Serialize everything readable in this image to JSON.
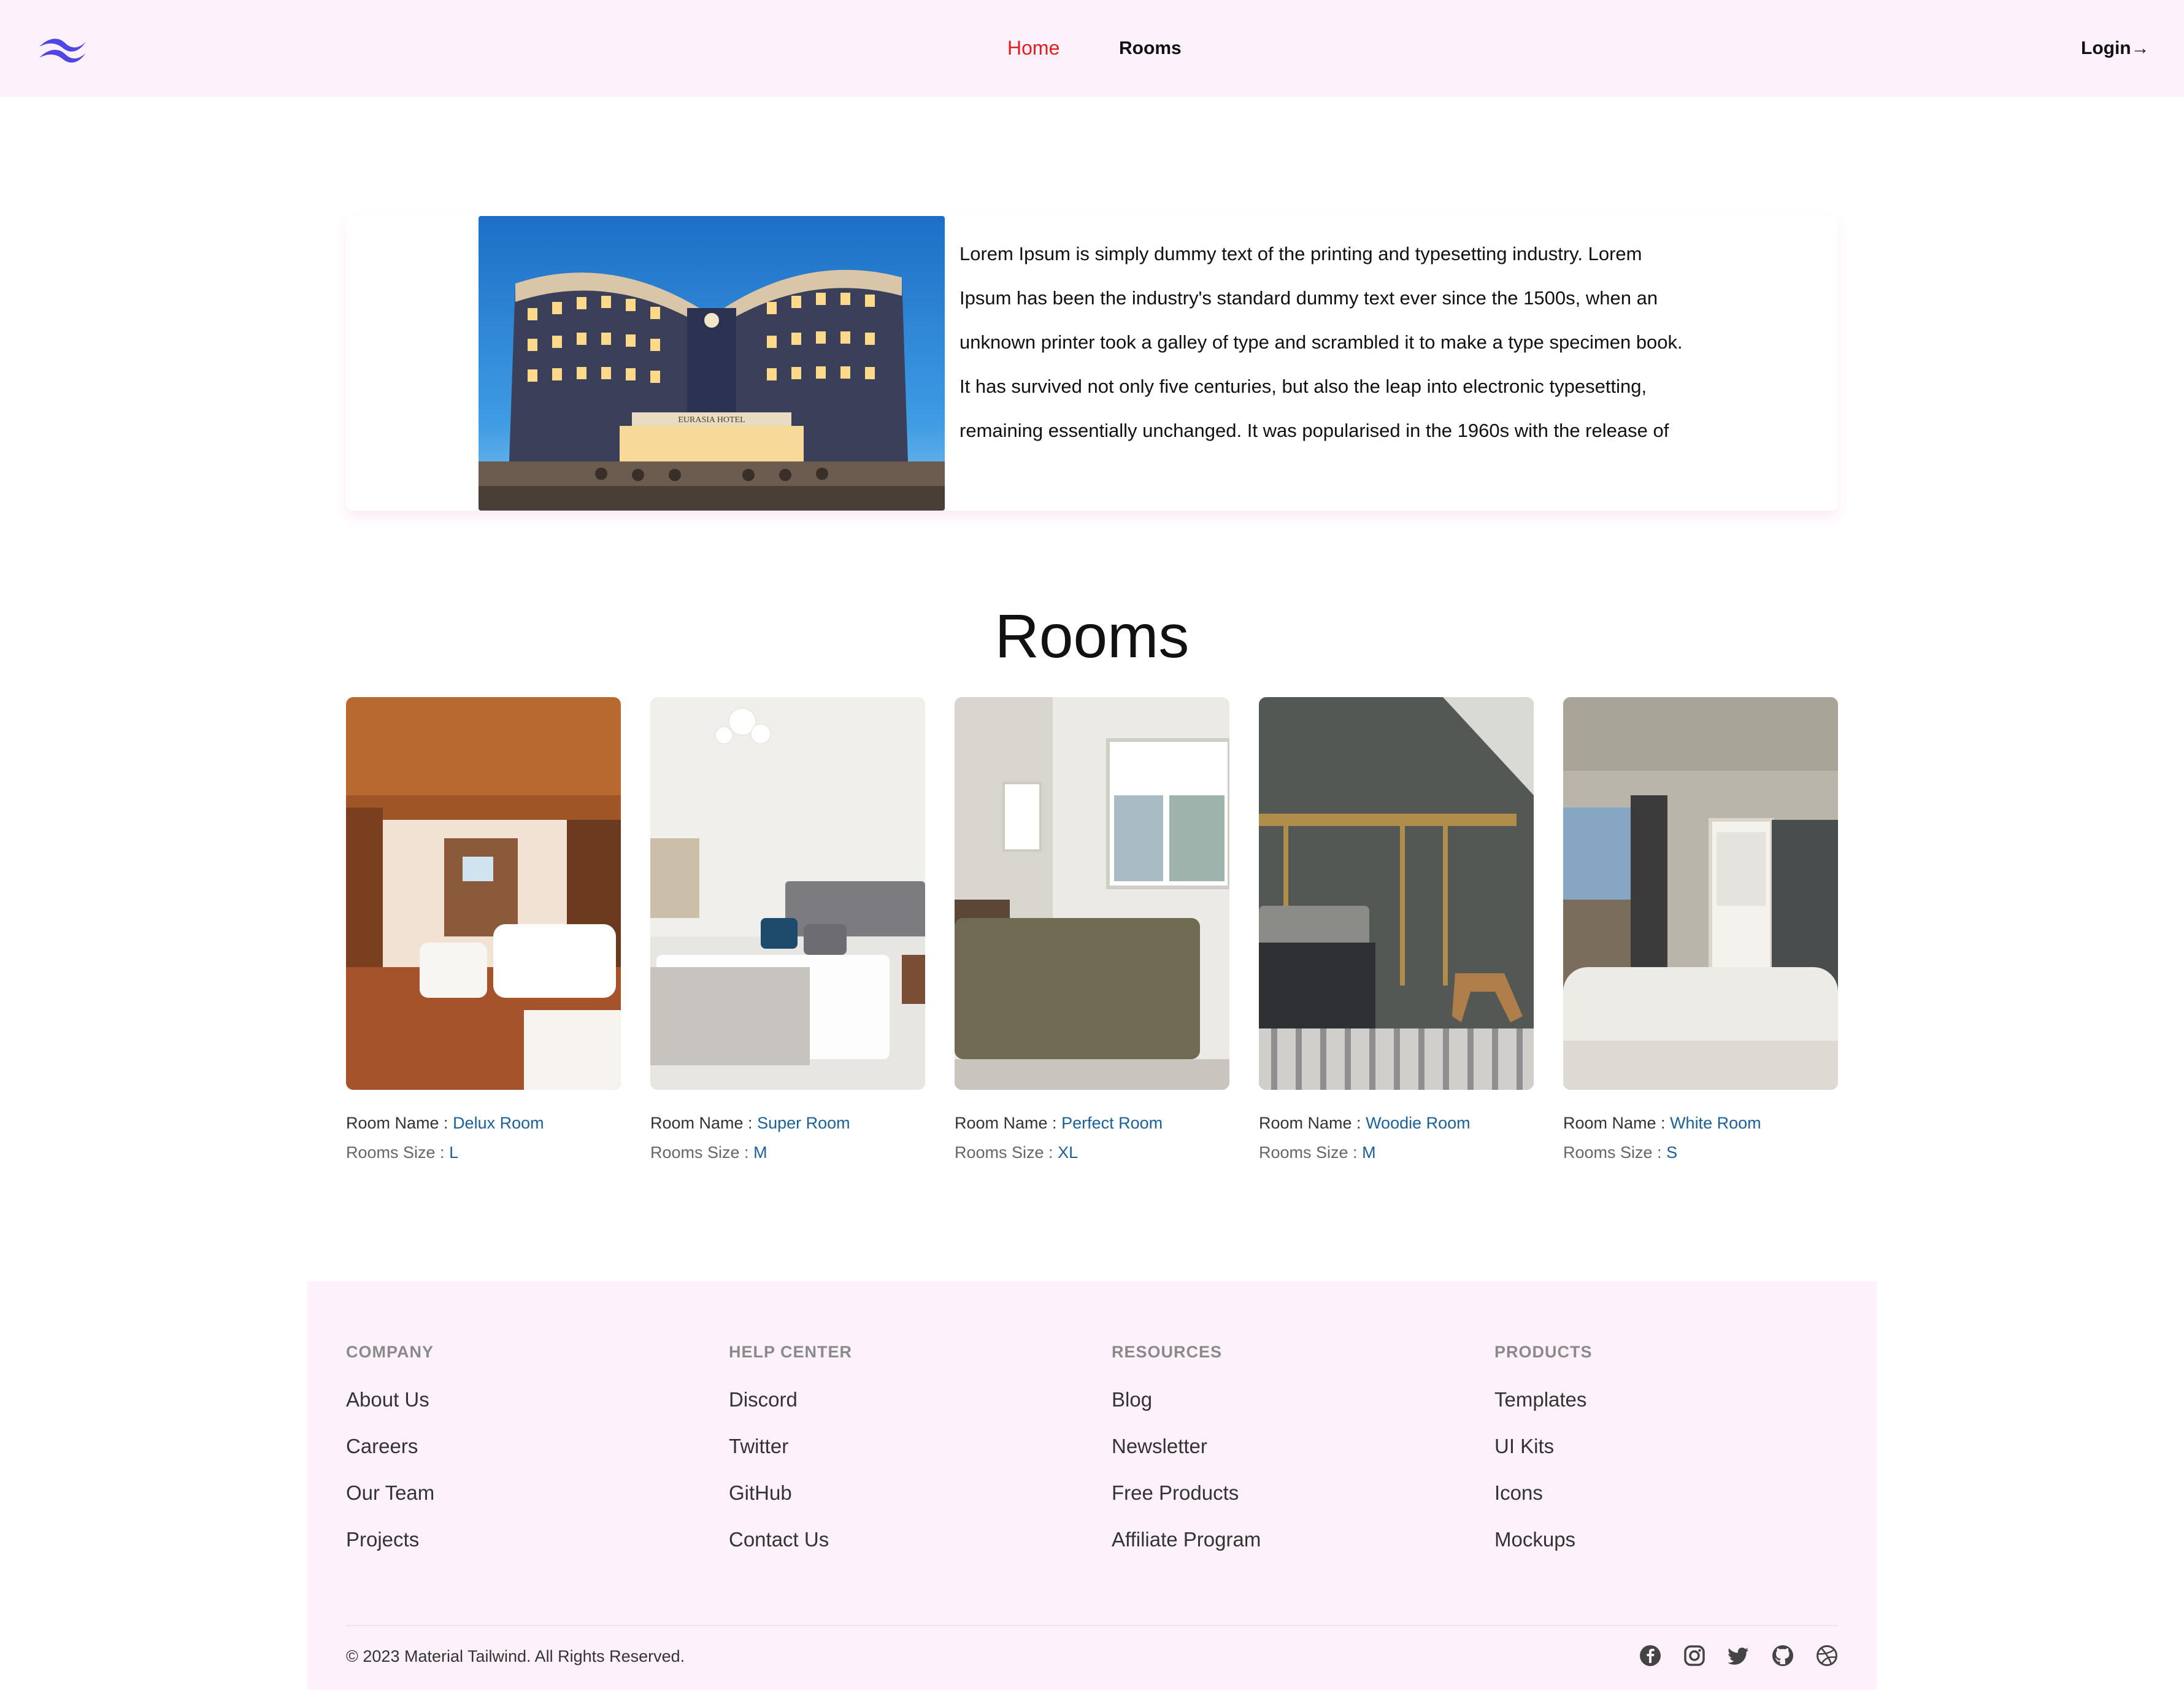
{
  "nav": {
    "home": "Home",
    "rooms": "Rooms",
    "login": "Login",
    "login_arrow": "→"
  },
  "hero": {
    "text": "Lorem Ipsum is simply dummy text of the printing and typesetting industry. Lorem Ipsum has been the industry's standard dummy text ever since the 1500s, when an unknown printer took a galley of type and scrambled it to make a type specimen book. It has survived not only five centuries, but also the leap into electronic typesetting, remaining essentially unchanged. It was popularised in the 1960s with the release of",
    "image_sign": "EURASIA HOTEL"
  },
  "rooms": {
    "title": "Rooms",
    "name_label": "Room Name : ",
    "size_label": "Rooms Size : ",
    "items": [
      {
        "name": "Delux Room",
        "size": "L"
      },
      {
        "name": "Super Room",
        "size": "M"
      },
      {
        "name": "Perfect Room",
        "size": "XL"
      },
      {
        "name": "Woodie Room",
        "size": "M"
      },
      {
        "name": "White Room",
        "size": "S"
      }
    ]
  },
  "footer": {
    "columns": [
      {
        "heading": "COMPANY",
        "links": [
          "About Us",
          "Careers",
          "Our Team",
          "Projects"
        ]
      },
      {
        "heading": "HELP CENTER",
        "links": [
          "Discord",
          "Twitter",
          "GitHub",
          "Contact Us"
        ]
      },
      {
        "heading": "RESOURCES",
        "links": [
          "Blog",
          "Newsletter",
          "Free Products",
          "Affiliate Program"
        ]
      },
      {
        "heading": "PRODUCTS",
        "links": [
          "Templates",
          "UI Kits",
          "Icons",
          "Mockups"
        ]
      }
    ],
    "copyright": "© 2023 Material Tailwind. All Rights Reserved.",
    "socials": [
      "facebook-icon",
      "instagram-icon",
      "twitter-icon",
      "github-icon",
      "dribbble-icon"
    ]
  },
  "colors": {
    "accent_red": "#e11d22",
    "link_blue": "#1d5f99",
    "logo_indigo": "#4f46e5",
    "navbar_bg": "#fdf2fb"
  }
}
